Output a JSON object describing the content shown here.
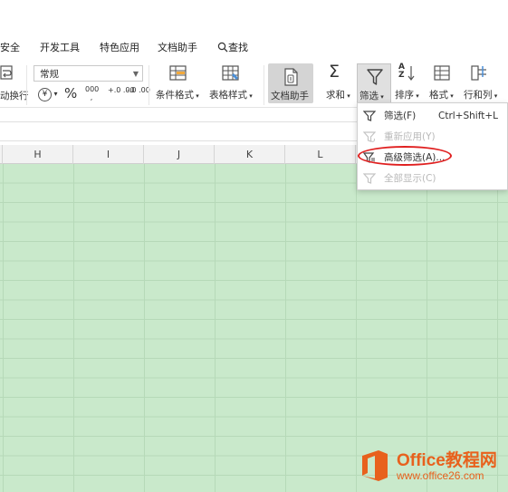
{
  "tabs": [
    "安全",
    "开发工具",
    "特色应用",
    "文档助手",
    "查找"
  ],
  "ribbon": {
    "wrap_label": "动换行",
    "number_format": "常规",
    "currency_symbol": "¥",
    "percent_symbol": "%",
    "thousands_symbol": "000",
    "inc_decimal": "+.0 .00",
    "dec_decimal": "-.0 .00",
    "conditional_format": "条件格式",
    "table_style": "表格样式",
    "doc_assistant": "文档助手",
    "sum": "求和",
    "filter": "筛选",
    "sort": "排序",
    "format": "格式",
    "row_col": "行和列"
  },
  "columns": [
    "H",
    "I",
    "J",
    "K",
    "L"
  ],
  "filter_menu": {
    "items": [
      {
        "label": "筛选(F)",
        "shortcut": "Ctrl+Shift+L",
        "enabled": true
      },
      {
        "label": "重新应用(Y)",
        "shortcut": "",
        "enabled": false
      },
      {
        "label": "高级筛选(A)...",
        "shortcut": "",
        "enabled": true,
        "highlighted": true
      },
      {
        "label": "全部显示(C)",
        "shortcut": "",
        "enabled": false
      }
    ]
  },
  "watermark": {
    "title": "Office教程网",
    "url": "www.office26.com"
  },
  "colors": {
    "sheet_fill": "#c9e9cb",
    "highlight_ring": "#e02020",
    "watermark": "#e8611d"
  }
}
